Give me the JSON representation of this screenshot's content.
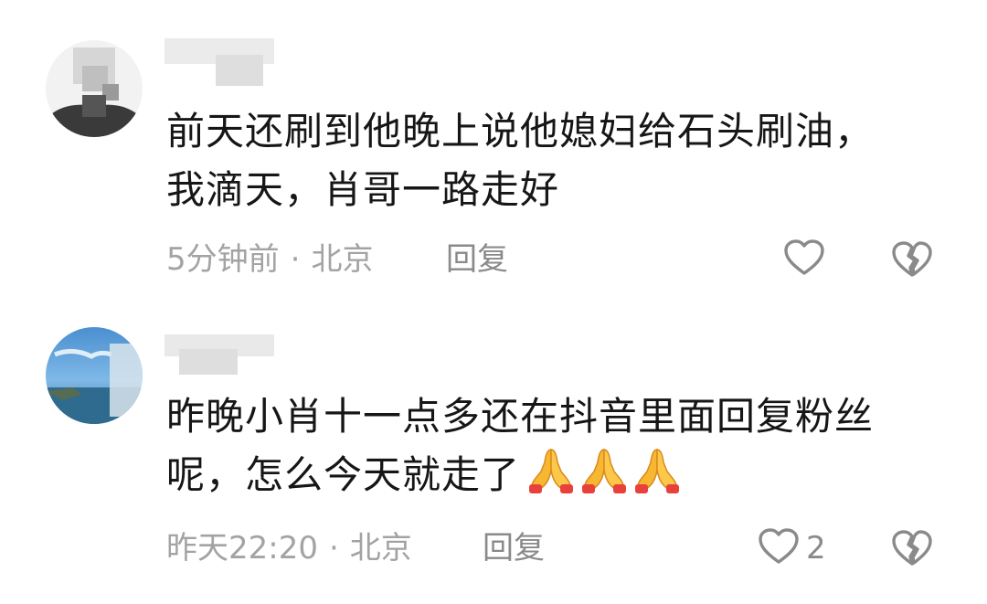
{
  "comments": [
    {
      "username": "",
      "text_line1": "前天还刷到他晚上说他媳妇给石头刷油，",
      "text_line2": "我滴天，肖哥一路走好",
      "time": "5分钟前",
      "separator": "·",
      "location": "北京",
      "reply_label": "回复",
      "like_count": ""
    },
    {
      "username": "",
      "text_line1": "昨晚小肖十一点多还在抖音里面回复粉丝",
      "text_line2": "呢，怎么今天就走了",
      "emoji": [
        "folded-hands-icon",
        "folded-hands-icon",
        "folded-hands-icon"
      ],
      "time": "昨天22:20",
      "separator": "·",
      "location": "北京",
      "reply_label": "回复",
      "like_count": "2"
    }
  ],
  "colors": {
    "text": "#161616",
    "meta": "#a3a3a3",
    "icon": "#8a8a8a"
  }
}
